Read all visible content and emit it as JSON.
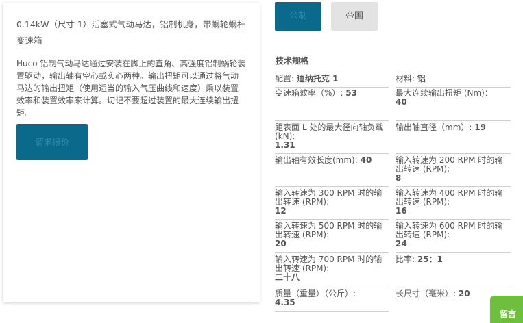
{
  "product": {
    "title": "0.14kW（尺寸 1）活塞式气动马达，铝制机身，带蜗轮蜗杆变速箱",
    "description": "Huco 铝制气动马达通过安装在脚上的直角、高强度铝制蜗轮装置驱动，输出轴有空心或实心两种。输出扭矩可以通过将气动马达的输出扭矩（使用适当的输入气压曲线和速度）乘以装置效率和装置效率来计算。切记不要超过装置的最大连续输出扭矩。",
    "quote_label": "请求报价"
  },
  "units": {
    "metric_label": "公制",
    "imperial_label": "帝国"
  },
  "specs": {
    "heading": "技术规格",
    "items": [
      {
        "label": "配置: ",
        "value": "迪纳托克 1"
      },
      {
        "label": "材料: ",
        "value": "铝"
      },
      {
        "label": "变速箱效率（%）: ",
        "value": "53"
      },
      {
        "label": "最大连续输出扭矩 (Nm)：",
        "value": "40"
      },
      {
        "label": "距表面 L 处的最大径向轴负载 (kN):",
        "value": "1.31"
      },
      {
        "label": "输出轴直径（mm）: ",
        "value": "19"
      },
      {
        "label": "输出轴有效长度(mm): ",
        "value": "40"
      },
      {
        "label": "输入转速为 200 RPM 时的输出转速 (RPM):",
        "value": "8"
      },
      {
        "label": "输入转速为 300 RPM 时的输出转速 (RPM):",
        "value": "12"
      },
      {
        "label": "输入转速为 400 RPM 时的输出转速 (RPM):",
        "value": "16"
      },
      {
        "label": "输入转速为 500 RPM 时的输出转速 (RPM):",
        "value": "20"
      },
      {
        "label": "输入转速为 600 RPM 时的输出转速 (RPM):",
        "value": "24"
      },
      {
        "label": "输入转速为 700 RPM 时的输出转速 (RPM):",
        "value": "二十八"
      },
      {
        "label": "比率: ",
        "value": "25：1"
      },
      {
        "label": "质量（重量）（公斤）: ",
        "value": "4.35"
      },
      {
        "label": "长尺寸（毫米）: ",
        "value": "20"
      }
    ]
  },
  "chat": {
    "label": "留言"
  },
  "colors": {
    "primary": "#0b6a8c",
    "secondary": "#e3e3e3",
    "chat": "#6fbf3e"
  }
}
